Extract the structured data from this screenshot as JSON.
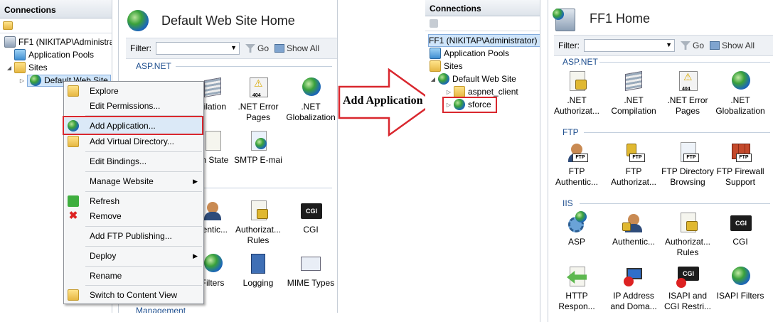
{
  "left": {
    "connections_title": "Connections",
    "tree": {
      "server": "FF1 (NIKITAP\\Administrat",
      "app_pools": "Application Pools",
      "sites": "Sites",
      "default_site": "Default Web Site"
    },
    "home_title": "Default Web Site Home",
    "filter": {
      "label": "Filter:",
      "go": "Go",
      "show_all": "Show All"
    },
    "section_aspnet": "ASP.NET",
    "section_management": "Management",
    "features_visible": [
      {
        "label1": "",
        "label2": "oilation",
        "icon": "compile-icon"
      },
      {
        "label1": ".NET Error",
        "label2": "Pages",
        "icon": "error-pages-icon"
      },
      {
        "label1": ".NET",
        "label2": "Globalization",
        "icon": "globe-icon"
      },
      {
        "label1": "on State",
        "label2": "",
        "icon": "state-icon"
      },
      {
        "label1": "SMTP E-mai",
        "label2": "",
        "icon": "smtp-icon"
      },
      {
        "label1": "nentic...",
        "label2": "",
        "icon": "auth-icon"
      },
      {
        "label1": "Authorizat...",
        "label2": "Rules",
        "icon": "auth-rules-icon"
      },
      {
        "label1": "CGI",
        "label2": "",
        "icon": "cgi-icon"
      },
      {
        "label1": "Filters",
        "label2": "",
        "icon": "filters-icon"
      },
      {
        "label1": "Logging",
        "label2": "",
        "icon": "logging-icon"
      },
      {
        "label1": "MIME Types",
        "label2": "",
        "icon": "mime-icon"
      }
    ],
    "context_menu": {
      "explore": "Explore",
      "edit_permissions": "Edit Permissions...",
      "add_application": "Add Application...",
      "add_virtual_directory": "Add Virtual Directory...",
      "edit_bindings": "Edit Bindings...",
      "manage_website": "Manage Website",
      "refresh": "Refresh",
      "remove": "Remove",
      "add_ftp_publishing": "Add FTP Publishing...",
      "deploy": "Deploy",
      "rename": "Rename",
      "switch_content_view": "Switch to Content View"
    }
  },
  "annotation": {
    "label": "Add Application",
    "arrow_color": "#d9272e"
  },
  "right": {
    "connections_title": "Connections",
    "tree": {
      "server": "FF1 (NIKITAP\\Administrator)",
      "app_pools": "Application Pools",
      "sites": "Sites",
      "default_site": "Default Web Site",
      "aspnet_client": "aspnet_client",
      "sforce": "sforce"
    },
    "home_title": "FF1 Home",
    "filter": {
      "label": "Filter:",
      "go": "Go",
      "show_all": "Show All"
    },
    "sections": {
      "aspnet": "ASP.NET",
      "ftp": "FTP",
      "iis": "IIS"
    },
    "aspnet_features": [
      {
        "l1": ".NET",
        "l2": "Authorizat...",
        "icon": "authorization-icon"
      },
      {
        "l1": ".NET",
        "l2": "Compilation",
        "icon": "compilation-icon"
      },
      {
        "l1": ".NET Error",
        "l2": "Pages",
        "icon": "error-pages-icon"
      },
      {
        "l1": ".NET",
        "l2": "Globalization",
        "icon": "globalization-icon"
      }
    ],
    "ftp_features": [
      {
        "l1": "FTP",
        "l2": "Authentic...",
        "icon": "ftp-auth-icon"
      },
      {
        "l1": "FTP",
        "l2": "Authorizat...",
        "icon": "ftp-authz-icon"
      },
      {
        "l1": "FTP Directory",
        "l2": "Browsing",
        "icon": "ftp-dir-icon"
      },
      {
        "l1": "FTP Firewall",
        "l2": "Support",
        "icon": "ftp-firewall-icon"
      }
    ],
    "iis_features": [
      {
        "l1": "ASP",
        "l2": "",
        "icon": "asp-icon"
      },
      {
        "l1": "Authentic...",
        "l2": "",
        "icon": "authentication-icon"
      },
      {
        "l1": "Authorizat...",
        "l2": "Rules",
        "icon": "authorization-rules-icon"
      },
      {
        "l1": "CGI",
        "l2": "",
        "icon": "cgi-icon"
      }
    ],
    "iis_features2": [
      {
        "l1": "HTTP",
        "l2": "Respon...",
        "icon": "http-response-icon"
      },
      {
        "l1": "IP Address",
        "l2": "and Doma...",
        "icon": "ip-address-icon"
      },
      {
        "l1": "ISAPI and",
        "l2": "CGI Restri...",
        "icon": "isapi-cgi-icon"
      },
      {
        "l1": "ISAPI Filters",
        "l2": "",
        "icon": "isapi-filters-icon"
      }
    ]
  }
}
